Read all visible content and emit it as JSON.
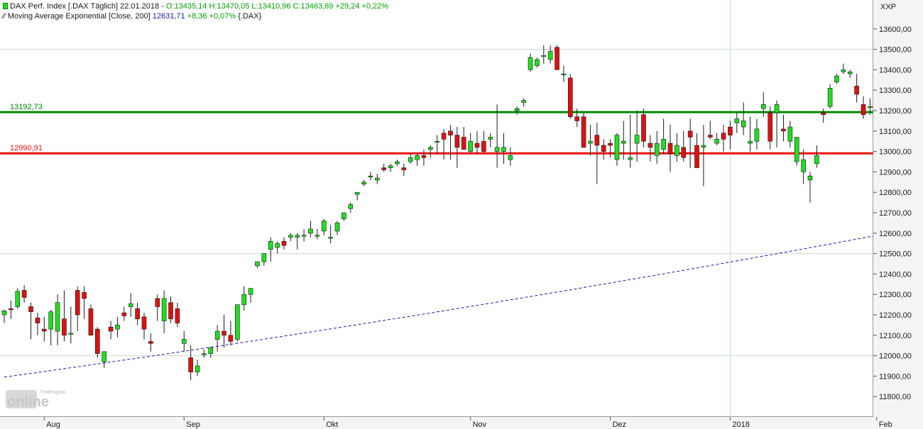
{
  "legend": {
    "line1_prefix": "DAX Perf. Index [.DAX  Täglich] 22.01.2018 - ",
    "line1_values": "O:13435,14 H:13470,05 L:13410,96 C:13463,69 +29,24 +0,22%",
    "line2_prefix": "Moving Average Exponential [Close, 200] ",
    "line2_value": "12631,71",
    "line2_change": " +8,36 +0,07%",
    "line2_suffix": " {.DAX}"
  },
  "currency_label": "XXP",
  "logo": {
    "brand": "Tradesignal",
    "text": "online"
  },
  "colors": {
    "up": "#22dd22",
    "down": "#dd1111",
    "support_green": "#008800",
    "support_red": "#ee1111",
    "ema": "#1a1aa0",
    "grid": "#c8dcc8"
  },
  "chart_data": {
    "type": "candlestick",
    "title": "DAX Perf. Index",
    "ylim": [
      11700,
      13700
    ],
    "y_ticks": [
      "11800,00",
      "11900,00",
      "12000,00",
      "12100,00",
      "12200,00",
      "12300,00",
      "12400,00",
      "12500,00",
      "12600,00",
      "12700,00",
      "12800,00",
      "12900,00",
      "13000,00",
      "13100,00",
      "13200,00",
      "13300,00",
      "13400,00",
      "13500,00",
      "13600,00"
    ],
    "x_month_labels": [
      "Aug",
      "Sep",
      "Okt",
      "Nov",
      "Dez",
      "2018",
      "Feb"
    ],
    "x_month_index": [
      6,
      27,
      48,
      70,
      91,
      109,
      131
    ],
    "major_y_gridlines": [
      12000,
      12500,
      13500
    ],
    "horizontal_lines": [
      {
        "label": "13192,73",
        "value": 13192.73,
        "color": "#008800"
      },
      {
        "label": "12990,91",
        "value": 12990.91,
        "color": "#ee1111"
      }
    ],
    "ema": {
      "name": "Moving Average Exponential [Close, 200]",
      "start": 11895,
      "end": 12631.71
    },
    "candles": [
      [
        12200,
        12225,
        12160,
        12220
      ],
      [
        12230,
        12270,
        12180,
        12225
      ],
      [
        12240,
        12330,
        12230,
        12315
      ],
      [
        12320,
        12345,
        12260,
        12285
      ],
      [
        12240,
        12260,
        12080,
        12215
      ],
      [
        12185,
        12210,
        12100,
        12160
      ],
      [
        12130,
        12190,
        12070,
        12120
      ],
      [
        12130,
        12225,
        12050,
        12215
      ],
      [
        12120,
        12300,
        12050,
        12260
      ],
      [
        12180,
        12320,
        12070,
        12100
      ],
      [
        12105,
        12240,
        12060,
        12110
      ],
      [
        12320,
        12340,
        12120,
        12200
      ],
      [
        12310,
        12340,
        12180,
        12280
      ],
      [
        12230,
        12250,
        12130,
        12100
      ],
      [
        12130,
        12140,
        11990,
        12010
      ],
      [
        11970,
        12010,
        11940,
        12020
      ],
      [
        12140,
        12170,
        12080,
        12120
      ],
      [
        12130,
        12190,
        12090,
        12150
      ],
      [
        12210,
        12240,
        12170,
        12195
      ],
      [
        12240,
        12305,
        12190,
        12255
      ],
      [
        12230,
        12260,
        12150,
        12180
      ],
      [
        12190,
        12210,
        12080,
        12130
      ],
      [
        12070,
        12110,
        12020,
        12060
      ],
      [
        12280,
        12300,
        12170,
        12240
      ],
      [
        12170,
        12320,
        12110,
        12280
      ],
      [
        12260,
        12290,
        12160,
        12180
      ],
      [
        12230,
        12260,
        12140,
        12160
      ],
      [
        12060,
        12120,
        12020,
        12080
      ],
      [
        11990,
        12050,
        11880,
        11920
      ],
      [
        11920,
        11980,
        11900,
        11950
      ],
      [
        12010,
        12030,
        11990,
        12010
      ],
      [
        12010,
        12040,
        11990,
        12040
      ],
      [
        12080,
        12150,
        12020,
        12120
      ],
      [
        12120,
        12200,
        12040,
        12100
      ],
      [
        12100,
        12170,
        12050,
        12070
      ],
      [
        12080,
        12240,
        12070,
        12250
      ],
      [
        12250,
        12340,
        12220,
        12300
      ],
      [
        12300,
        12320,
        12260,
        12330
      ],
      [
        12440,
        12460,
        12430,
        12460
      ],
      [
        12460,
        12500,
        12440,
        12500
      ],
      [
        12520,
        12580,
        12460,
        12560
      ],
      [
        12530,
        12560,
        12500,
        12550
      ],
      [
        12560,
        12580,
        12520,
        12540
      ],
      [
        12580,
        12600,
        12560,
        12590
      ],
      [
        12580,
        12600,
        12520,
        12590
      ],
      [
        12590,
        12620,
        12560,
        12590
      ],
      [
        12600,
        12660,
        12580,
        12620
      ],
      [
        12590,
        12620,
        12570,
        12590
      ],
      [
        12610,
        12670,
        12590,
        12660
      ],
      [
        12580,
        12640,
        12550,
        12580
      ],
      [
        12610,
        12660,
        12590,
        12650
      ],
      [
        12670,
        12700,
        12660,
        12700
      ],
      [
        12720,
        12750,
        12700,
        12740
      ],
      [
        12790,
        12800,
        12760,
        12800
      ],
      [
        12840,
        12860,
        12830,
        12850
      ],
      [
        12880,
        12900,
        12860,
        12880
      ],
      [
        12860,
        12890,
        12840,
        12870
      ],
      [
        12920,
        12940,
        12900,
        12910
      ],
      [
        12920,
        12940,
        12900,
        12930
      ],
      [
        12940,
        12960,
        12930,
        12950
      ],
      [
        12920,
        12940,
        12880,
        12910
      ],
      [
        12950,
        12990,
        12940,
        12970
      ],
      [
        12960,
        12990,
        12930,
        12980
      ],
      [
        12980,
        13010,
        12930,
        12970
      ],
      [
        13010,
        13030,
        12970,
        13020
      ],
      [
        13050,
        13080,
        12990,
        13050
      ],
      [
        13090,
        13110,
        12960,
        13060
      ],
      [
        13100,
        13130,
        12960,
        13080
      ],
      [
        13080,
        13120,
        12920,
        13020
      ],
      [
        13070,
        13120,
        13010,
        13010
      ],
      [
        13000,
        13090,
        12990,
        13050
      ],
      [
        13040,
        13100,
        12990,
        13020
      ],
      [
        13050,
        13100,
        12990,
        13000
      ],
      [
        13060,
        13090,
        13020,
        13070
      ],
      [
        13000,
        13230,
        12920,
        13020
      ],
      [
        13000,
        13090,
        12940,
        13020
      ],
      [
        12960,
        13020,
        12930,
        12980
      ],
      [
        13200,
        13220,
        13180,
        13210
      ],
      [
        13240,
        13260,
        13220,
        13250
      ],
      [
        13400,
        13480,
        13390,
        13460
      ],
      [
        13420,
        13460,
        13410,
        13450
      ],
      [
        13470,
        13520,
        13430,
        13470
      ],
      [
        13450,
        13520,
        13430,
        13490
      ],
      [
        13510,
        13520,
        13400,
        13400
      ],
      [
        13380,
        13420,
        13340,
        13380
      ],
      [
        13360,
        13380,
        13160,
        13170
      ],
      [
        13170,
        13210,
        13120,
        13150
      ],
      [
        13170,
        13190,
        13030,
        13020
      ],
      [
        13040,
        13130,
        12980,
        13050
      ],
      [
        13080,
        13140,
        12840,
        13030
      ],
      [
        13030,
        13060,
        12960,
        13000
      ],
      [
        13040,
        13060,
        12970,
        13030
      ],
      [
        12960,
        13090,
        12930,
        13080
      ],
      [
        13040,
        13150,
        12960,
        13050
      ],
      [
        12960,
        13180,
        12920,
        12970
      ],
      [
        13040,
        13200,
        12950,
        13080
      ],
      [
        13180,
        13210,
        13020,
        13050
      ],
      [
        13040,
        13080,
        12950,
        13020
      ],
      [
        12980,
        13100,
        12940,
        13040
      ],
      [
        13010,
        13160,
        12990,
        13060
      ],
      [
        13040,
        13130,
        12900,
        12990
      ],
      [
        12980,
        13090,
        12950,
        13030
      ],
      [
        13020,
        13100,
        12950,
        12970
      ],
      [
        13100,
        13160,
        12920,
        13070
      ],
      [
        13030,
        13090,
        13000,
        12920
      ],
      [
        13020,
        13130,
        12830,
        13030
      ],
      [
        13080,
        13150,
        13060,
        13070
      ],
      [
        13040,
        13090,
        13030,
        13060
      ],
      [
        13090,
        13130,
        13000,
        13060
      ],
      [
        13120,
        13150,
        13010,
        13080
      ],
      [
        13140,
        13190,
        13090,
        13160
      ],
      [
        13120,
        13240,
        13080,
        13150
      ],
      [
        13040,
        13170,
        13000,
        13050
      ],
      [
        13050,
        13160,
        13010,
        13110
      ],
      [
        13210,
        13290,
        13170,
        13230
      ],
      [
        13190,
        13220,
        13010,
        13050
      ],
      [
        13190,
        13250,
        13020,
        13230
      ],
      [
        13110,
        13180,
        13050,
        13100
      ],
      [
        13050,
        13150,
        13020,
        13120
      ],
      [
        12950,
        13040,
        12930,
        13070
      ],
      [
        12900,
        13010,
        12840,
        12960
      ],
      [
        12860,
        12900,
        12750,
        12880
      ],
      [
        12940,
        13030,
        12920,
        12980
      ],
      [
        13190,
        13210,
        13140,
        13180
      ],
      [
        13220,
        13330,
        13210,
        13310
      ],
      [
        13340,
        13380,
        13330,
        13370
      ],
      [
        13390,
        13430,
        13380,
        13400
      ],
      [
        13380,
        13400,
        13360,
        13390
      ],
      [
        13320,
        13380,
        13240,
        13280
      ],
      [
        13230,
        13270,
        13160,
        13180
      ],
      [
        13220,
        13260,
        13180,
        13220
      ],
      [
        13180,
        13220,
        13140,
        13200
      ],
      [
        13200,
        13260,
        13180,
        13240
      ],
      [
        13230,
        13360,
        13180,
        13230
      ],
      [
        13170,
        13230,
        13140,
        13190
      ],
      [
        13220,
        13270,
        13210,
        13250
      ],
      [
        13260,
        13320,
        13250,
        13310
      ],
      [
        13320,
        13440,
        13300,
        13430
      ],
      [
        13435.14,
        13470.05,
        13410.96,
        13463.69
      ]
    ]
  }
}
